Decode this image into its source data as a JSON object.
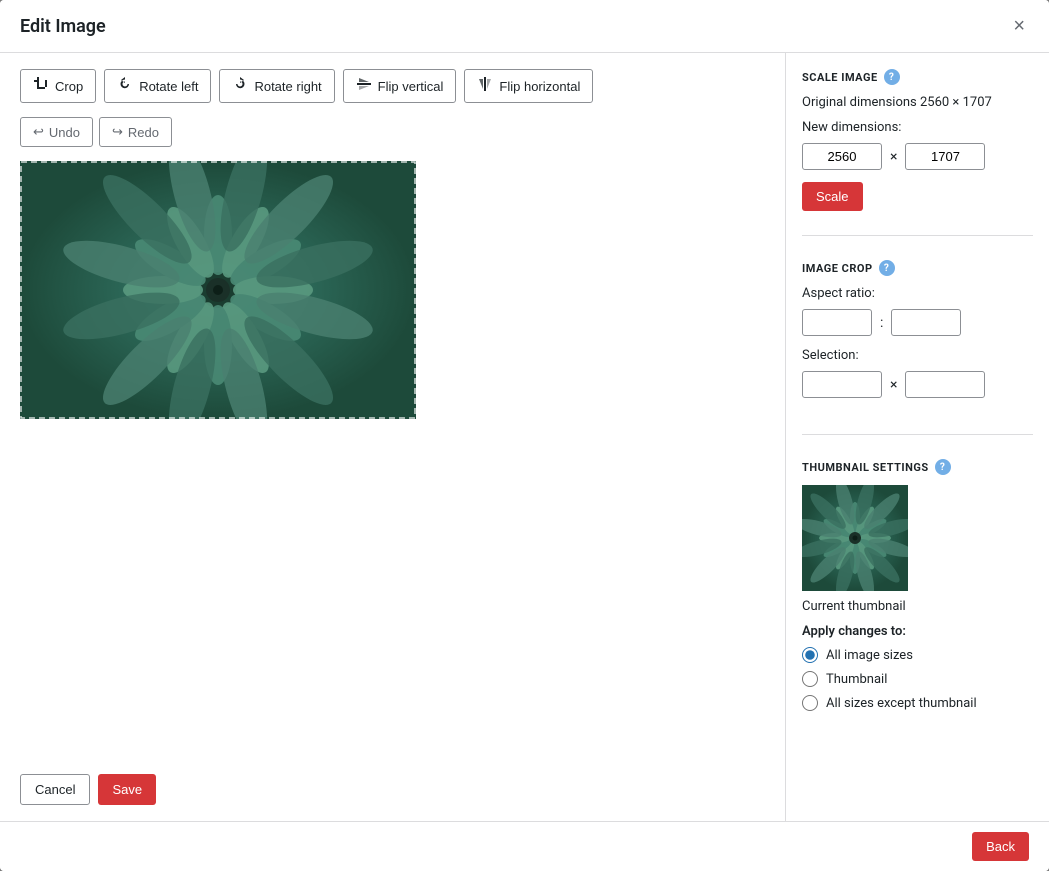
{
  "modal": {
    "title": "Edit Image",
    "close_label": "×"
  },
  "toolbar": {
    "crop_label": "Crop",
    "rotate_left_label": "Rotate left",
    "rotate_right_label": "Rotate right",
    "flip_vertical_label": "Flip vertical",
    "flip_horizontal_label": "Flip horizontal",
    "undo_label": "Undo",
    "redo_label": "Redo"
  },
  "action_buttons": {
    "cancel_label": "Cancel",
    "save_label": "Save"
  },
  "sidebar": {
    "scale_section_title": "SCALE IMAGE",
    "original_dimensions_label": "Original dimensions 2560 × 1707",
    "new_dimensions_label": "New dimensions:",
    "width_value": "2560",
    "height_value": "1707",
    "scale_button_label": "Scale",
    "crop_section_title": "IMAGE CROP",
    "aspect_ratio_label": "Aspect ratio:",
    "aspect_width_value": "",
    "aspect_height_value": "",
    "selection_label": "Selection:",
    "selection_width_value": "",
    "selection_height_value": "",
    "thumbnail_section_title": "THUMBNAIL SETTINGS",
    "current_thumbnail_label": "Current thumbnail",
    "apply_changes_label": "Apply changes to:",
    "radio_options": [
      {
        "id": "all-sizes",
        "label": "All image sizes",
        "checked": true
      },
      {
        "id": "thumbnail",
        "label": "Thumbnail",
        "checked": false
      },
      {
        "id": "all-except-thumbnail",
        "label": "All sizes except thumbnail",
        "checked": false
      }
    ]
  },
  "footer": {
    "back_label": "Back"
  },
  "icons": {
    "crop": "⊡",
    "rotate_left": "↺",
    "rotate_right": "↻",
    "flip_vertical": "⇅",
    "flip_horizontal": "⇄",
    "undo": "↩",
    "redo": "↪",
    "help": "?"
  }
}
